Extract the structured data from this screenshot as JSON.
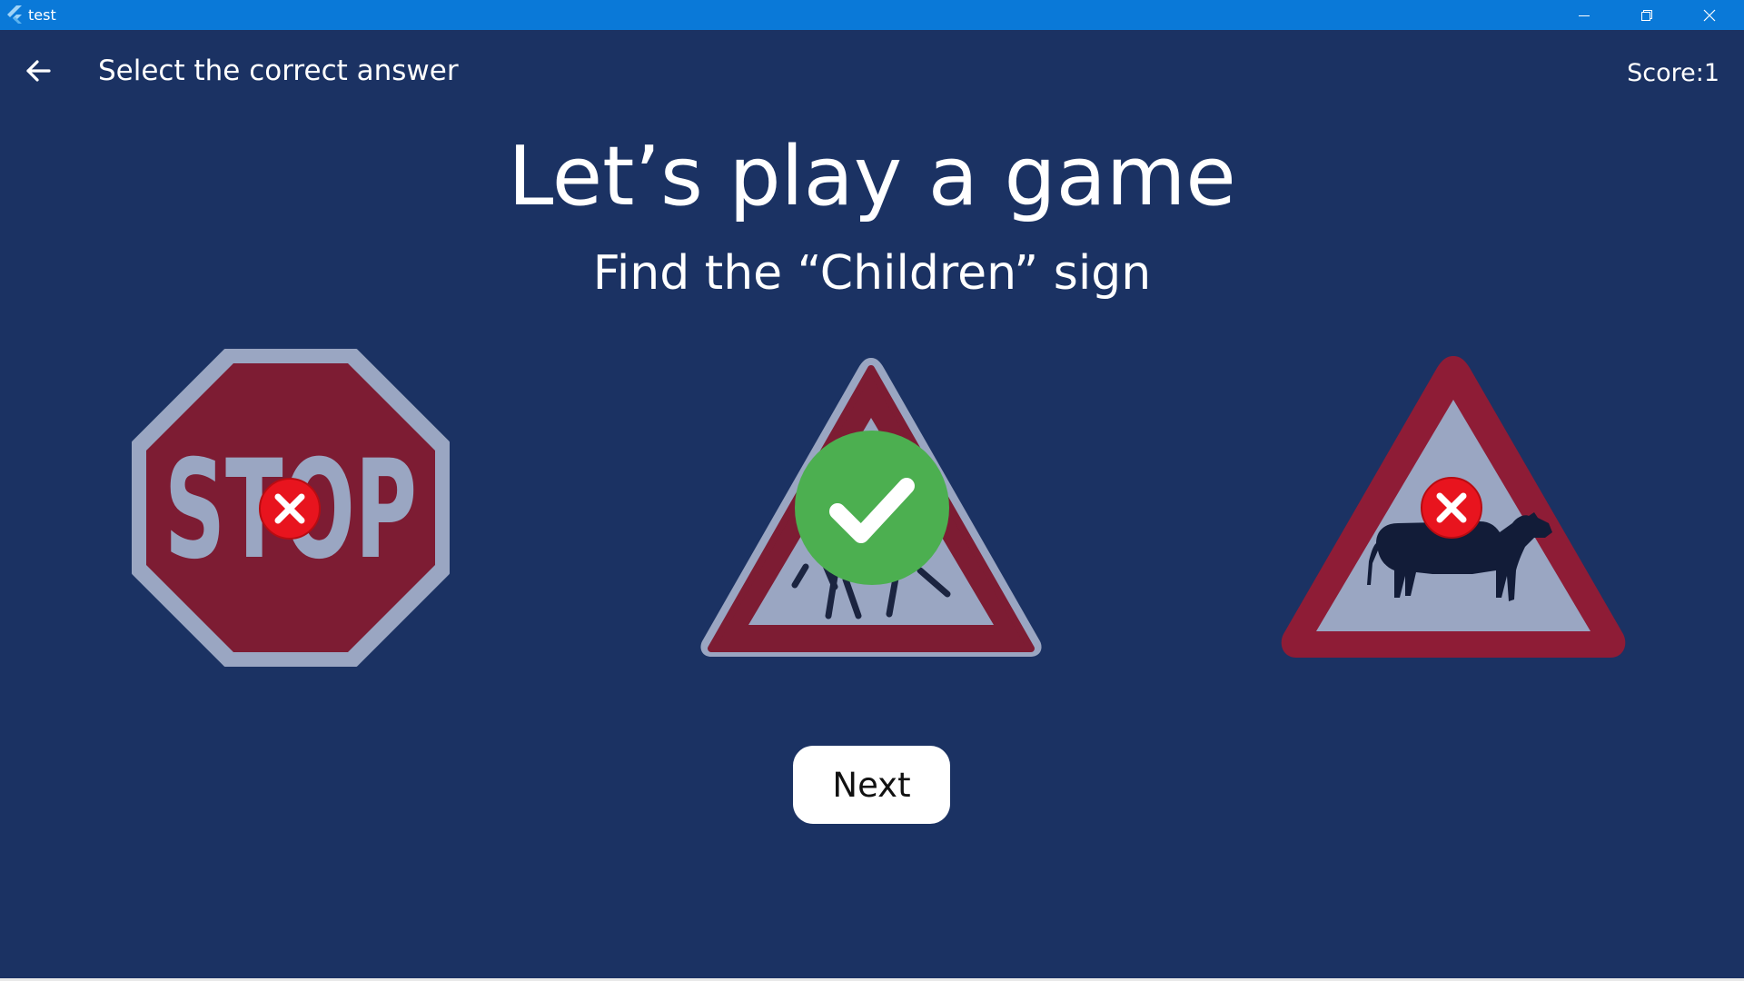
{
  "window": {
    "title": "test",
    "logo_icon": "flutter-logo-icon",
    "controls": [
      "minimize-icon",
      "restore-icon",
      "close-icon"
    ]
  },
  "appbar": {
    "back_icon": "arrow-left-icon",
    "title": "Select the correct answer",
    "score_label": "Score:",
    "score_value": "1"
  },
  "game": {
    "heading": "Let’s play a game",
    "prompt": "Find the “Children” sign",
    "options": [
      {
        "sign": "stop-sign",
        "sign_text": "STOP",
        "result": "wrong",
        "result_icon": "cross-icon"
      },
      {
        "sign": "children-crossing-sign",
        "result": "correct",
        "result_icon": "checkmark-icon"
      },
      {
        "sign": "cattle-crossing-sign",
        "result": "wrong",
        "result_icon": "cross-icon"
      }
    ],
    "next_label": "Next"
  },
  "colors": {
    "background": "#1b3263",
    "titlebar": "#0a79d8",
    "sign_red": "#7d1c33",
    "sign_grey": "#9aa6c2",
    "correct_green": "#4caf50",
    "wrong_red": "#e8141e"
  }
}
